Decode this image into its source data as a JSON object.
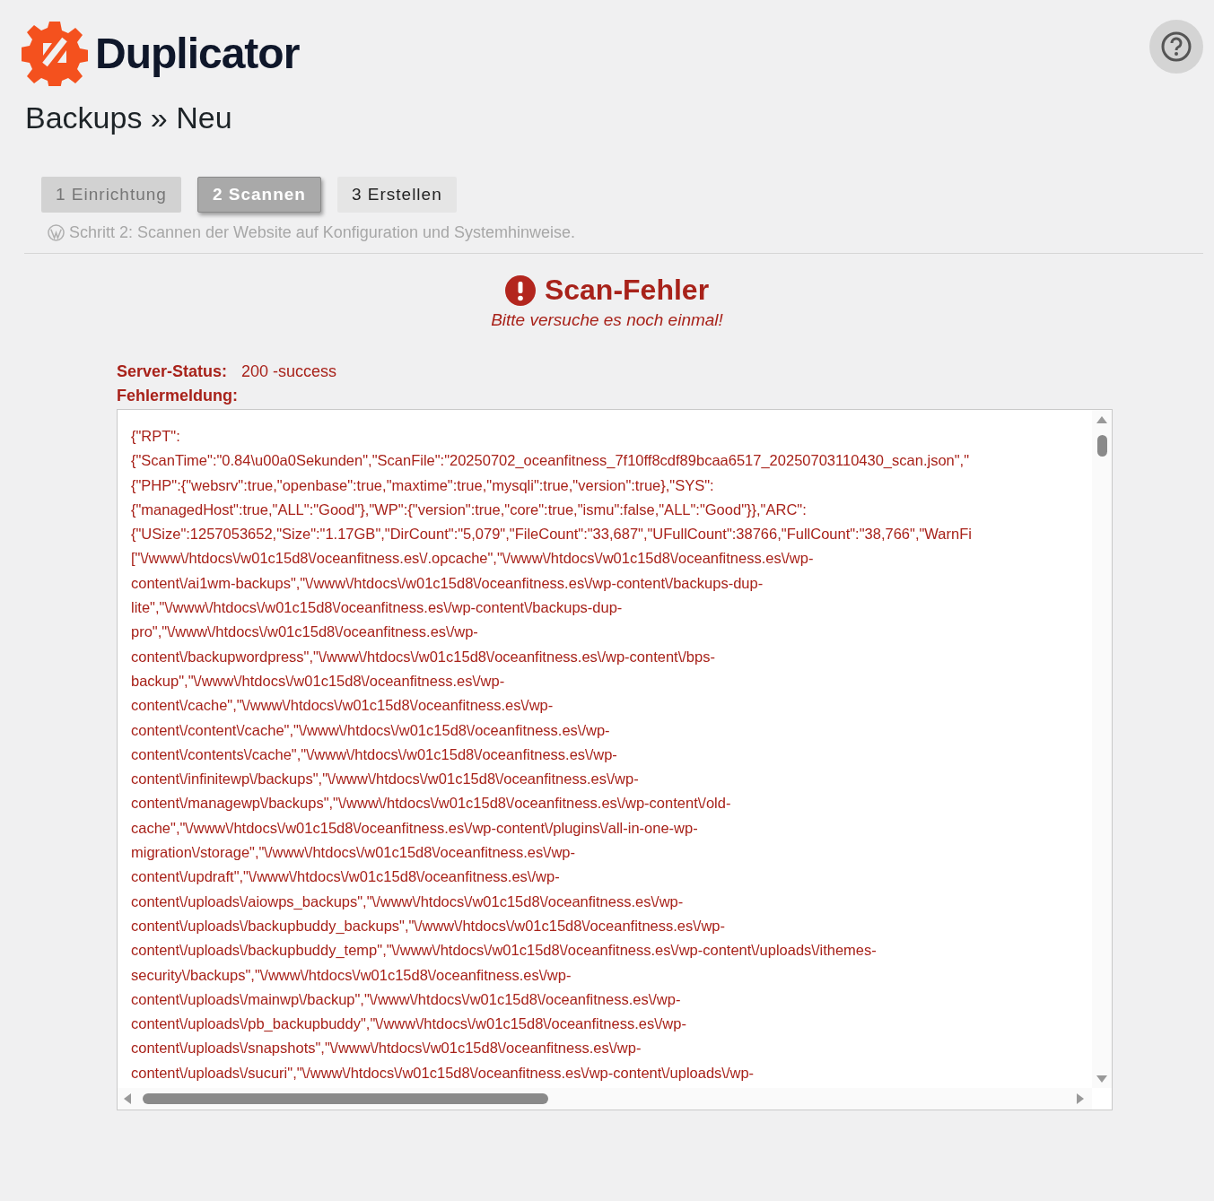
{
  "header": {
    "logo_text": "Duplicator"
  },
  "page_title": "Backups » Neu",
  "steps": [
    {
      "label": "1 Einrichtung",
      "selected": false,
      "done": true
    },
    {
      "label": "2 Scannen",
      "selected": true,
      "done": false
    },
    {
      "label": "3 Erstellen",
      "selected": false,
      "done": false
    }
  ],
  "step_hint": "Schritt 2: Scannen der Website auf Konfiguration und Systemhinweise.",
  "error": {
    "title": "Scan-Fehler",
    "subtitle": "Bitte versuche es noch einmal!"
  },
  "server_status": {
    "label": "Server-Status:",
    "value": "200 -success"
  },
  "message_label": "Fehlermeldung:",
  "message_lines": [
    "{\"RPT\":",
    "{\"ScanTime\":\"0.84\\u00a0Sekunden\",\"ScanFile\":\"20250702_oceanfitness_7f10ff8cdf89bcaa6517_20250703110430_scan.json\",\"",
    "{\"PHP\":{\"websrv\":true,\"openbase\":true,\"maxtime\":true,\"mysqli\":true,\"version\":true},\"SYS\":",
    "{\"managedHost\":true,\"ALL\":\"Good\"},\"WP\":{\"version\":true,\"core\":true,\"ismu\":false,\"ALL\":\"Good\"}},\"ARC\":",
    "{\"USize\":1257053652,\"Size\":\"1.17GB\",\"DirCount\":\"5,079\",\"FileCount\":\"33,687\",\"UFullCount\":38766,\"FullCount\":\"38,766\",\"WarnFi",
    "[\"\\/www\\/htdocs\\/w01c15d8\\/oceanfitness.es\\/.opcache\",\"\\/www\\/htdocs\\/w01c15d8\\/oceanfitness.es\\/wp-",
    "content\\/ai1wm-backups\",\"\\/www\\/htdocs\\/w01c15d8\\/oceanfitness.es\\/wp-content\\/backups-dup-",
    "lite\",\"\\/www\\/htdocs\\/w01c15d8\\/oceanfitness.es\\/wp-content\\/backups-dup-",
    "pro\",\"\\/www\\/htdocs\\/w01c15d8\\/oceanfitness.es\\/wp-",
    "content\\/backupwordpress\",\"\\/www\\/htdocs\\/w01c15d8\\/oceanfitness.es\\/wp-content\\/bps-",
    "backup\",\"\\/www\\/htdocs\\/w01c15d8\\/oceanfitness.es\\/wp-",
    "content\\/cache\",\"\\/www\\/htdocs\\/w01c15d8\\/oceanfitness.es\\/wp-",
    "content\\/content\\/cache\",\"\\/www\\/htdocs\\/w01c15d8\\/oceanfitness.es\\/wp-",
    "content\\/contents\\/cache\",\"\\/www\\/htdocs\\/w01c15d8\\/oceanfitness.es\\/wp-",
    "content\\/infinitewp\\/backups\",\"\\/www\\/htdocs\\/w01c15d8\\/oceanfitness.es\\/wp-",
    "content\\/managewp\\/backups\",\"\\/www\\/htdocs\\/w01c15d8\\/oceanfitness.es\\/wp-content\\/old-",
    "cache\",\"\\/www\\/htdocs\\/w01c15d8\\/oceanfitness.es\\/wp-content\\/plugins\\/all-in-one-wp-",
    "migration\\/storage\",\"\\/www\\/htdocs\\/w01c15d8\\/oceanfitness.es\\/wp-",
    "content\\/updraft\",\"\\/www\\/htdocs\\/w01c15d8\\/oceanfitness.es\\/wp-",
    "content\\/uploads\\/aiowps_backups\",\"\\/www\\/htdocs\\/w01c15d8\\/oceanfitness.es\\/wp-",
    "content\\/uploads\\/backupbuddy_backups\",\"\\/www\\/htdocs\\/w01c15d8\\/oceanfitness.es\\/wp-",
    "content\\/uploads\\/backupbuddy_temp\",\"\\/www\\/htdocs\\/w01c15d8\\/oceanfitness.es\\/wp-content\\/uploads\\/ithemes-",
    "security\\/backups\",\"\\/www\\/htdocs\\/w01c15d8\\/oceanfitness.es\\/wp-",
    "content\\/uploads\\/mainwp\\/backup\",\"\\/www\\/htdocs\\/w01c15d8\\/oceanfitness.es\\/wp-",
    "content\\/uploads\\/pb_backupbuddy\",\"\\/www\\/htdocs\\/w01c15d8\\/oceanfitness.es\\/wp-",
    "content\\/uploads\\/snapshots\",\"\\/www\\/htdocs\\/w01c15d8\\/oceanfitness.es\\/wp-",
    "content\\/uploads\\/sucuri\",\"\\/www\\/htdocs\\/w01c15d8\\/oceanfitness.es\\/wp-content\\/uploads\\/wp-"
  ]
}
